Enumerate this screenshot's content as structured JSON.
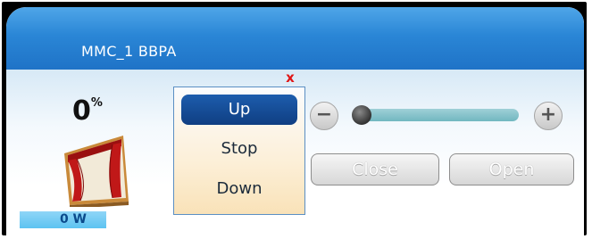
{
  "window": {
    "title": "MMC_1 BBPA"
  },
  "status": {
    "percent_value": "0",
    "percent_sign": "%",
    "power": "0 W"
  },
  "menu": {
    "close_symbol": "x",
    "items": [
      "Up",
      "Stop",
      "Down"
    ],
    "selected": "Up"
  },
  "slider": {
    "value_fraction": 0.0,
    "minus_symbol": "−",
    "plus_symbol": "+"
  },
  "buttons": {
    "close_label": "Close",
    "open_label": "Open"
  },
  "icons": {
    "curtain": "curtain-icon",
    "menu_close": "close-icon"
  }
}
